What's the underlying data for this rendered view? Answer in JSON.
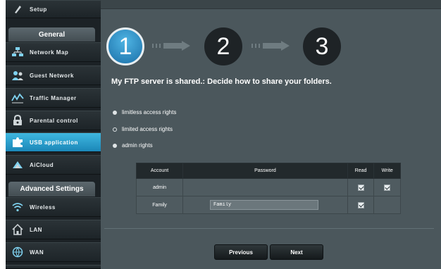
{
  "sidebar": {
    "top_item": {
      "label": "Setup",
      "icon": "setup-icon"
    },
    "general_header": "General",
    "items": [
      {
        "label": "Network Map",
        "icon": "network-map-icon"
      },
      {
        "label": "Guest Network",
        "icon": "guest-network-icon"
      },
      {
        "label": "Traffic Manager",
        "icon": "traffic-manager-icon"
      },
      {
        "label": "Parental control",
        "icon": "lock-icon"
      },
      {
        "label": "USB application",
        "icon": "puzzle-icon",
        "active": true
      },
      {
        "label": "AiCloud",
        "icon": "cloud-icon"
      }
    ],
    "advanced_header": "Advanced Settings",
    "advanced_items": [
      {
        "label": "Wireless",
        "icon": "wifi-icon"
      },
      {
        "label": "LAN",
        "icon": "home-icon"
      },
      {
        "label": "WAN",
        "icon": "globe-icon"
      }
    ]
  },
  "wizard": {
    "steps": [
      "1",
      "2",
      "3"
    ],
    "active_step": 1,
    "title": "My FTP server is shared.: Decide how to share your folders."
  },
  "options": [
    {
      "label": "limitless access rights",
      "style": "filled"
    },
    {
      "label": "limited access rights",
      "style": "ring"
    },
    {
      "label": "admin rights",
      "style": "filled"
    }
  ],
  "table": {
    "headers": [
      "Account",
      "Password",
      "Read",
      "Write"
    ],
    "rows": [
      {
        "account": "admin",
        "password": "",
        "read": true,
        "write": true
      },
      {
        "account": "Family",
        "password": "Family",
        "read": true,
        "write": false
      }
    ]
  },
  "buttons": {
    "previous": "Previous",
    "next": "Next"
  },
  "colors": {
    "accent": "#2a9ad0",
    "panel": "#4b575c",
    "sidebar": "#1c2226"
  }
}
